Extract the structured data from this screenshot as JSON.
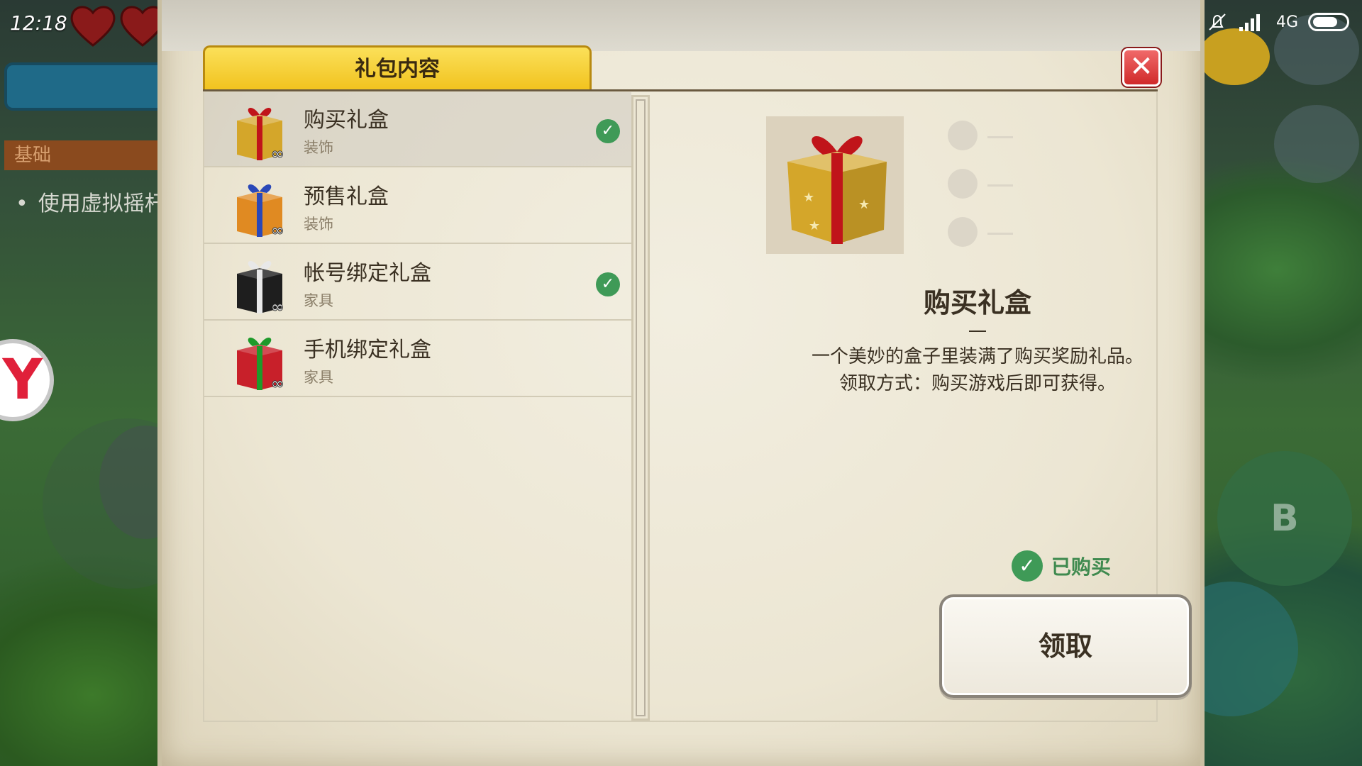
{
  "status_bar": {
    "time": "12:18",
    "network": "4G"
  },
  "game_hud": {
    "tab_label": "基础",
    "hint_text": "使用虚拟摇杆",
    "badge_text": "Y",
    "button_b": "B"
  },
  "dialog": {
    "tab_title": "礼包内容",
    "close_symbol": "✕",
    "items": [
      {
        "name": "购买礼盒",
        "category": "装饰",
        "owned": true,
        "color": "#d4a62a",
        "ribbon": "#c0141a"
      },
      {
        "name": "预售礼盒",
        "category": "装饰",
        "owned": false,
        "color": "#e08a22",
        "ribbon": "#2a48b8"
      },
      {
        "name": "帐号绑定礼盒",
        "category": "家具",
        "owned": true,
        "color": "#1e1e1e",
        "ribbon": "#e8e8e8"
      },
      {
        "name": "手机绑定礼盒",
        "category": "家具",
        "owned": false,
        "color": "#c8202a",
        "ribbon": "#1e9a2a"
      }
    ],
    "detail": {
      "title": "购买礼盒",
      "desc_line1": "一个美妙的盒子里装满了购买奖励礼品。",
      "desc_line2": "领取方式：购买游戏后即可获得。",
      "owned_label": "已购买",
      "claim_label": "领取"
    }
  }
}
